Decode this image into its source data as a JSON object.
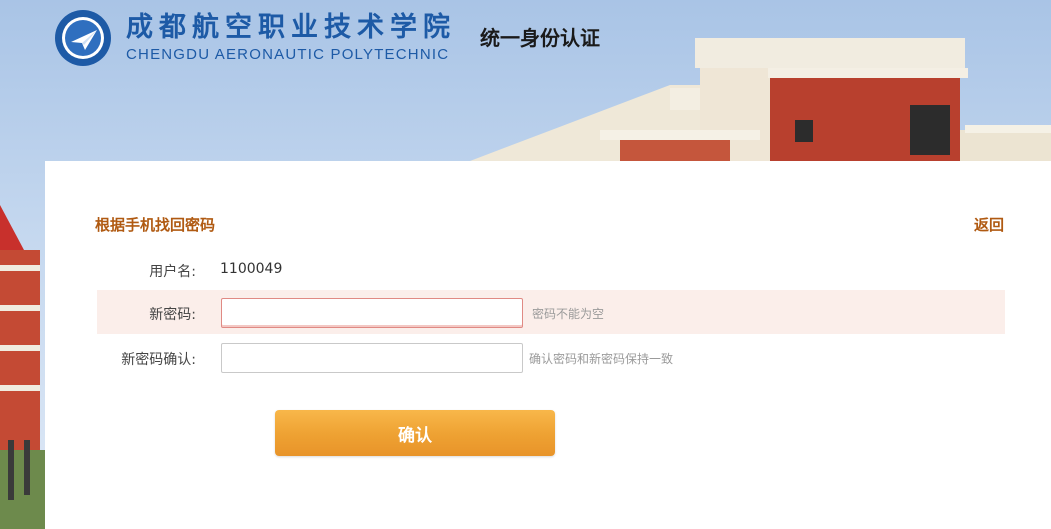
{
  "header": {
    "school_name_cn": "成都航空职业技术学院",
    "school_name_en": "CHENGDU AERONAUTIC POLYTECHNIC",
    "system_title": "统一身份认证",
    "logo_icon": "school-emblem-icon"
  },
  "form": {
    "title": "根据手机找回密码",
    "back_label": "返回",
    "username_label": "用户名:",
    "username_value": "1100049",
    "new_password_label": "新密码:",
    "new_password_value": "",
    "new_password_error": "密码不能为空",
    "confirm_password_label": "新密码确认:",
    "confirm_password_value": "",
    "confirm_password_hint": "确认密码和新密码保持一致",
    "submit_label": "确认"
  },
  "colors": {
    "brand_blue": "#1d5aa6",
    "accent_orange": "#eea132",
    "title_brown": "#b05a12",
    "error_bg": "#fbeeea",
    "error_border": "#e08a84"
  }
}
